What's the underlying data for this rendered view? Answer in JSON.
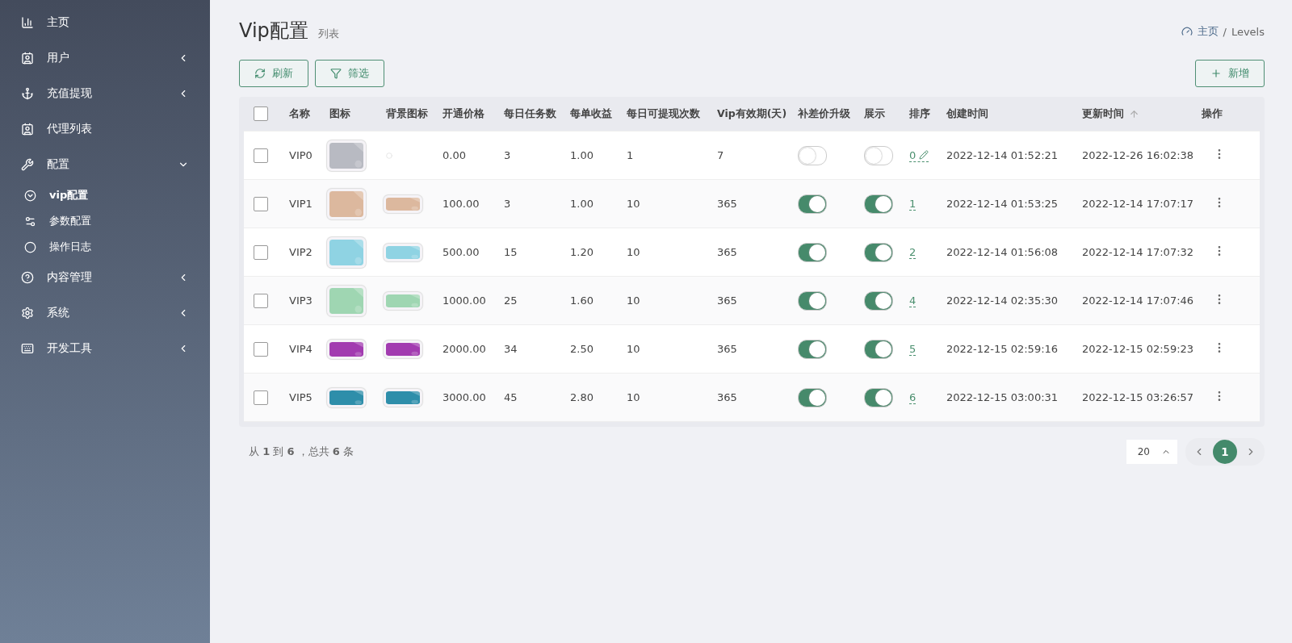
{
  "sidebar": {
    "items": [
      {
        "label": "主页"
      },
      {
        "label": "用户",
        "expanded": false
      },
      {
        "label": "充值提现",
        "expanded": false
      },
      {
        "label": "代理列表"
      },
      {
        "label": "配置",
        "expanded": true,
        "children": [
          {
            "label": "vip配置",
            "selected": true
          },
          {
            "label": "参数配置",
            "selected": false
          },
          {
            "label": "操作日志",
            "selected": false
          }
        ]
      },
      {
        "label": "内容管理",
        "expanded": false
      },
      {
        "label": "系统",
        "expanded": false
      },
      {
        "label": "开发工具",
        "expanded": false
      }
    ]
  },
  "header": {
    "title": "Vip配置",
    "subtitle": "列表",
    "breadcrumb": [
      "主页",
      "Levels"
    ],
    "separator": "/"
  },
  "toolbar": {
    "buttons": [
      "刷新",
      "筛选"
    ],
    "add_button": "新增"
  },
  "table": {
    "header_checked": false,
    "columns": [
      {
        "label": "名称",
        "sorted": false
      },
      {
        "label": "图标",
        "sorted": false
      },
      {
        "label": "背景图标",
        "sorted": false
      },
      {
        "label": "开通价格",
        "sorted": false
      },
      {
        "label": "每日任务数",
        "sorted": false
      },
      {
        "label": "每单收益",
        "sorted": false
      },
      {
        "label": "每日可提现次数",
        "sorted": false
      },
      {
        "label": "Vip有效期(天)",
        "sorted": false
      },
      {
        "label": "补差价升级",
        "sorted": false
      },
      {
        "label": "展示",
        "sorted": false
      },
      {
        "label": "排序",
        "sorted": false
      },
      {
        "label": "创建时间",
        "sorted": false
      },
      {
        "label": "更新时间",
        "sorted": true
      },
      {
        "label": "操作",
        "sorted": false
      }
    ],
    "rows": [
      {
        "checked": false,
        "name": "VIP0",
        "color": "#b8bac2",
        "bg_broken": true,
        "price": "0.00",
        "tasks": "3",
        "profit": "1.00",
        "withdrawals": "1",
        "days": "7",
        "upgrade": false,
        "show": false,
        "sort": "0",
        "editing": true,
        "created": "2022-12-14 01:52:21",
        "updated": "2022-12-26 16:02:38"
      },
      {
        "checked": false,
        "name": "VIP1",
        "color": "#dcb89e",
        "bg_broken": false,
        "price": "100.00",
        "tasks": "3",
        "profit": "1.00",
        "withdrawals": "10",
        "days": "365",
        "upgrade": true,
        "show": true,
        "sort": "1",
        "editing": false,
        "created": "2022-12-14 01:53:25",
        "updated": "2022-12-14 17:07:17"
      },
      {
        "checked": false,
        "name": "VIP2",
        "color": "#8fd3e3",
        "bg_broken": false,
        "price": "500.00",
        "tasks": "15",
        "profit": "1.20",
        "withdrawals": "10",
        "days": "365",
        "upgrade": true,
        "show": true,
        "sort": "2",
        "editing": false,
        "created": "2022-12-14 01:56:08",
        "updated": "2022-12-14 17:07:32"
      },
      {
        "checked": false,
        "name": "VIP3",
        "color": "#9fd6b2",
        "bg_broken": false,
        "price": "1000.00",
        "tasks": "25",
        "profit": "1.60",
        "withdrawals": "10",
        "days": "365",
        "upgrade": true,
        "show": true,
        "sort": "4",
        "editing": false,
        "created": "2022-12-14 02:35:30",
        "updated": "2022-12-14 17:07:46"
      },
      {
        "checked": false,
        "name": "VIP4",
        "color": "#a23bb0",
        "bg_broken": false,
        "price": "2000.00",
        "tasks": "34",
        "profit": "2.50",
        "withdrawals": "10",
        "days": "365",
        "upgrade": true,
        "show": true,
        "sort": "5",
        "editing": false,
        "created": "2022-12-15 02:59:16",
        "updated": "2022-12-15 02:59:23"
      },
      {
        "checked": false,
        "name": "VIP5",
        "color": "#2e8eaa",
        "bg_broken": false,
        "price": "3000.00",
        "tasks": "45",
        "profit": "2.80",
        "withdrawals": "10",
        "days": "365",
        "upgrade": true,
        "show": true,
        "sort": "6",
        "editing": false,
        "created": "2022-12-15 03:00:31",
        "updated": "2022-12-15 03:26:57"
      }
    ]
  },
  "footer": {
    "summary": "从 **1** 到 **6** ，总共 **6** 条",
    "page_size": "20",
    "pages": [
      {
        "label": "1",
        "selected": true
      }
    ]
  }
}
